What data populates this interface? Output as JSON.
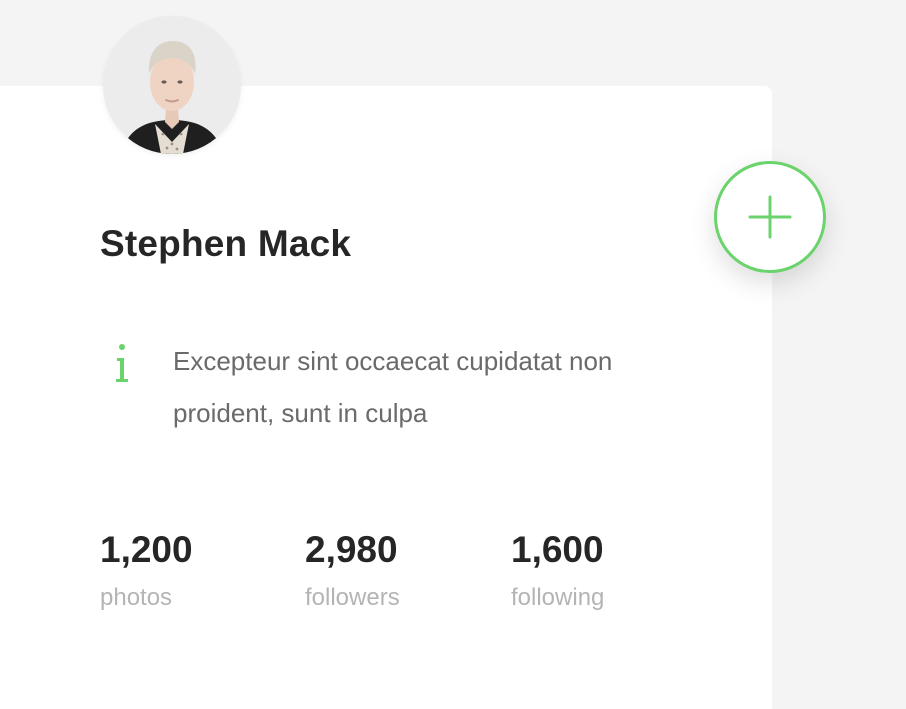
{
  "profile": {
    "name": "Stephen Mack",
    "bio": "Excepteur sint occaecat cupidatat non proident, sunt in culpa",
    "avatar_icon": "user-avatar",
    "info_icon": "info-icon",
    "add_icon": "plus-icon"
  },
  "stats": [
    {
      "value": "1,200",
      "label": "photos"
    },
    {
      "value": "2,980",
      "label": "followers"
    },
    {
      "value": "1,600",
      "label": "following"
    }
  ],
  "colors": {
    "accent": "#6bd36b",
    "text_dark": "#262626",
    "text_muted": "#6a6a6a",
    "label_gray": "#b4b4b4",
    "page_bg": "#f4f4f4",
    "card_bg": "#ffffff"
  }
}
